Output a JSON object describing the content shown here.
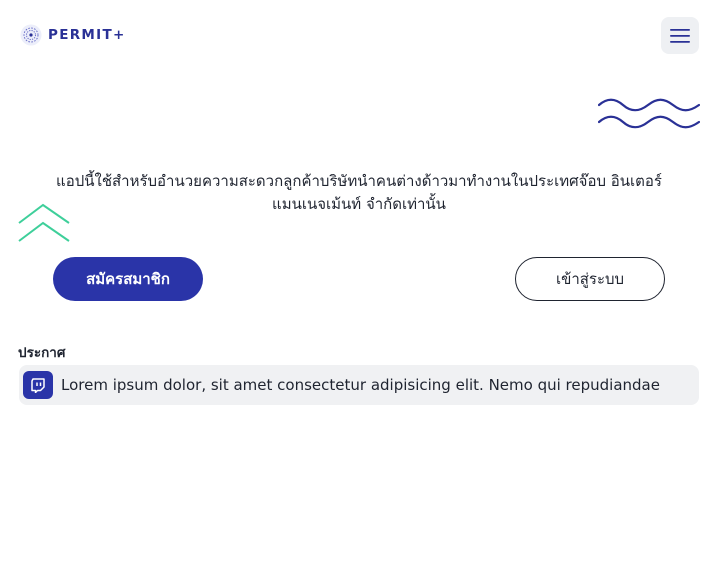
{
  "header": {
    "logo_text": "PERMIT+",
    "menu_icon": "hamburger-menu-icon"
  },
  "main": {
    "description": "แอปนี้ใช้สำหรับอำนวยความสะดวกลูกค้าบริษัทนำคนต่างด้าวมาทำงานในประเทศจ๊อบ อินเตอร์ แมนเนจเม้นท์ จำกัดเท่านั้น",
    "register_label": "สมัครสมาชิก",
    "login_label": "เข้าสู่ระบบ"
  },
  "announcement": {
    "label": "ประกาศ",
    "icon": "twitch-icon",
    "text": "Lorem ipsum dolor, sit amet consectetur adipisicing elit. Nemo qui repudiandae"
  },
  "colors": {
    "brand": "#2a34a8",
    "accent_teal": "#3ecf9a",
    "wave": "#2a3196"
  }
}
